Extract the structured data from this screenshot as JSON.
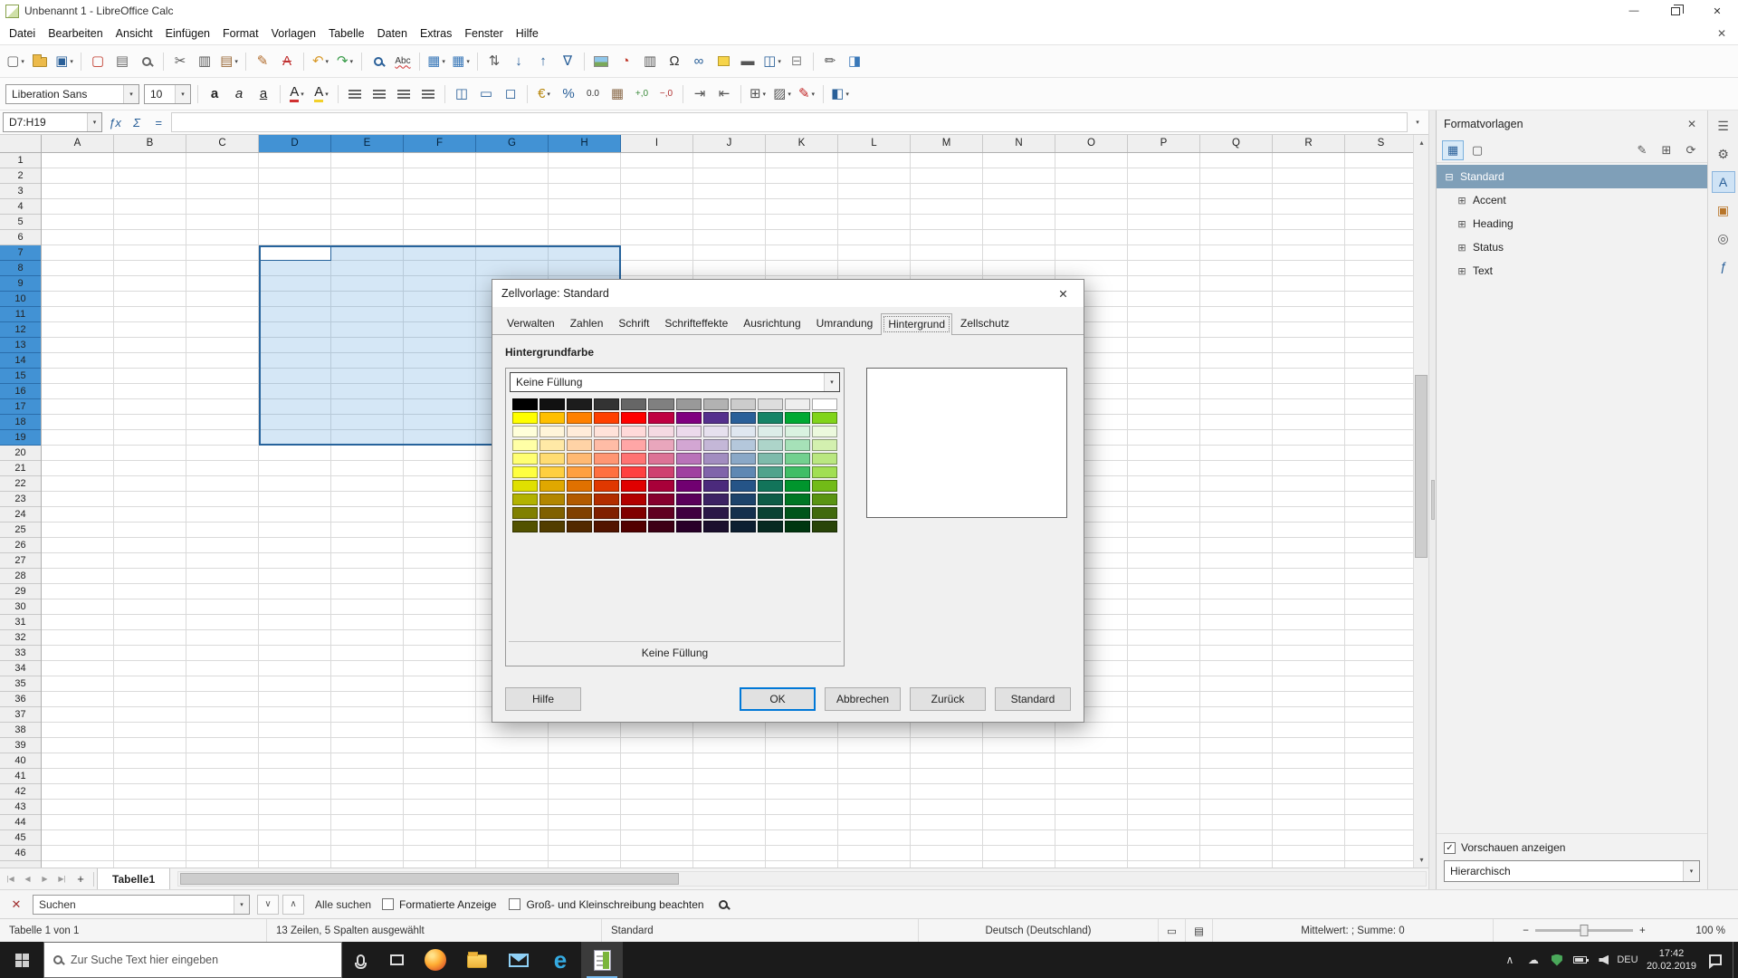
{
  "theme": {
    "selection_blue": "#4292d4",
    "ok_border": "#0078d7",
    "taskbar_bg": "#1b1b1b",
    "tree_selected": "#7f9fb8"
  },
  "window": {
    "title": "Unbenannt 1 - LibreOffice Calc",
    "minimize_glyph": "—",
    "close_glyph": "✕",
    "close_document_glyph": "✕"
  },
  "menubar": {
    "items": [
      "Datei",
      "Bearbeiten",
      "Ansicht",
      "Einfügen",
      "Format",
      "Vorlagen",
      "Tabelle",
      "Daten",
      "Extras",
      "Fenster",
      "Hilfe"
    ]
  },
  "toolbar_standard": {
    "items": [
      {
        "name": "new-button",
        "glyph": "▢",
        "color": "#666",
        "caret": true
      },
      {
        "name": "open-button",
        "cls": "ic-folder"
      },
      {
        "name": "save-button",
        "glyph": "▣",
        "color": "#2a6099",
        "caret": true
      },
      {
        "sep": true
      },
      {
        "name": "export-pdf-button",
        "glyph": "▢",
        "color": "#c0392b"
      },
      {
        "name": "print-button",
        "glyph": "▤",
        "color": "#666"
      },
      {
        "name": "print-preview-button",
        "cls": "ic-mag",
        "color": "#666"
      },
      {
        "sep": true
      },
      {
        "name": "cut-button",
        "glyph": "✂",
        "color": "#555"
      },
      {
        "name": "copy-button",
        "glyph": "▥",
        "color": "#555"
      },
      {
        "name": "paste-button",
        "glyph": "▤",
        "color": "#9a6a3a",
        "caret": true
      },
      {
        "sep": true
      },
      {
        "name": "clone-formatting-button",
        "glyph": "✎",
        "color": "#b06a2a"
      },
      {
        "name": "clear-formatting-button",
        "glyph": "A",
        "color": "#c03030",
        "strike": true
      },
      {
        "sep": true
      },
      {
        "name": "undo-button",
        "glyph": "↶",
        "color": "#d89a2a",
        "caret": true
      },
      {
        "name": "redo-button",
        "glyph": "↷",
        "color": "#3a9c4a",
        "caret": true
      },
      {
        "sep": true
      },
      {
        "name": "find-replace-button",
        "cls": "ic-mag",
        "color": "#2a6099"
      },
      {
        "name": "spelling-button",
        "glyph": "Abc",
        "color": "#333",
        "spell": true
      },
      {
        "sep": true
      },
      {
        "name": "insert-row-button",
        "glyph": "▦",
        "color": "#3a78b8",
        "caret": true
      },
      {
        "name": "insert-column-button",
        "glyph": "▦",
        "color": "#3a78b8",
        "caret": true
      },
      {
        "sep": true
      },
      {
        "name": "sort-button",
        "glyph": "⇅",
        "color": "#555"
      },
      {
        "name": "sort-ascending-button",
        "glyph": "↓",
        "color": "#2a6099"
      },
      {
        "name": "sort-descending-button",
        "glyph": "↑",
        "color": "#2a6099"
      },
      {
        "name": "autofilter-button",
        "glyph": "∇",
        "color": "#2a6099"
      },
      {
        "sep": true
      },
      {
        "name": "insert-image-button",
        "cls": "ic-pic"
      },
      {
        "name": "insert-chart-button",
        "glyph": "◔",
        "color": "#c0392b"
      },
      {
        "name": "insert-pivot-table-button",
        "glyph": "▥",
        "color": "#555"
      },
      {
        "name": "special-character-button",
        "glyph": "Ω",
        "color": "#333"
      },
      {
        "name": "insert-hyperlink-button",
        "glyph": "∞",
        "color": "#2a6099"
      },
      {
        "name": "insert-comment-button",
        "cls": "ic-note"
      },
      {
        "name": "headers-footers-button",
        "glyph": "▬",
        "color": "#555"
      },
      {
        "name": "freeze-button",
        "glyph": "◫",
        "color": "#2a6099",
        "caret": true
      },
      {
        "name": "split-window-button",
        "glyph": "⊟",
        "color": "#888"
      },
      {
        "sep": true
      },
      {
        "name": "show-draw-functions-button",
        "glyph": "✏",
        "color": "#555"
      },
      {
        "name": "sidebar-button",
        "glyph": "◨",
        "color": "#3a78b8"
      }
    ]
  },
  "toolbar_formatting": {
    "items": [
      {
        "type": "combo",
        "name": "font-name-combo",
        "value": "Liberation Sans",
        "width": 148
      },
      {
        "type": "combo",
        "name": "font-size-combo",
        "value": "10",
        "width": 52
      },
      {
        "sep": true
      },
      {
        "name": "bold-button",
        "glyph": "a",
        "color": "#222",
        "bold": true
      },
      {
        "name": "italic-button",
        "glyph": "a",
        "color": "#222",
        "italic": true
      },
      {
        "name": "underline-button",
        "glyph": "a",
        "color": "#222",
        "underline": true
      },
      {
        "sep": true
      },
      {
        "name": "font-color-button",
        "glyph": "A",
        "color": "#222",
        "ubar": "#d03030",
        "caret": true
      },
      {
        "name": "highlighting-color-button",
        "glyph": "A",
        "color": "#222",
        "ubar": "#f2d02a",
        "caret": true
      },
      {
        "sep": true
      },
      {
        "name": "align-left-button",
        "bars": "l"
      },
      {
        "name": "align-center-button",
        "bars": "c"
      },
      {
        "name": "align-right-button",
        "bars": "r"
      },
      {
        "name": "align-justified-button",
        "bars": "j"
      },
      {
        "sep": true
      },
      {
        "name": "merge-and-center-button",
        "glyph": "◫",
        "color": "#2a6099"
      },
      {
        "name": "merge-cells-button",
        "glyph": "▭",
        "color": "#2a6099"
      },
      {
        "name": "unmerge-cells-button",
        "glyph": "◻",
        "color": "#2a6099"
      },
      {
        "sep": true
      },
      {
        "name": "format-currency-button",
        "glyph": "€",
        "color": "#b8860b",
        "caret": true
      },
      {
        "name": "format-percent-button",
        "glyph": "%",
        "color": "#2a6099"
      },
      {
        "name": "format-number-button",
        "glyph": "0.0",
        "color": "#333",
        "small": true
      },
      {
        "name": "format-date-button",
        "glyph": "▦",
        "color": "#8a6a4a"
      },
      {
        "name": "add-decimal-button",
        "glyph": "+,0",
        "color": "#3a8a3a",
        "small": true
      },
      {
        "name": "delete-decimal-button",
        "glyph": "−,0",
        "color": "#b03030",
        "small": true
      },
      {
        "sep": true
      },
      {
        "name": "increase-indent-button",
        "glyph": "⇥",
        "color": "#555"
      },
      {
        "name": "decrease-indent-button",
        "glyph": "⇤",
        "color": "#555"
      },
      {
        "sep": true
      },
      {
        "name": "borders-button",
        "glyph": "⊞",
        "color": "#555",
        "caret": true
      },
      {
        "name": "border-style-button",
        "glyph": "▨",
        "color": "#555",
        "caret": true
      },
      {
        "name": "border-color-button",
        "glyph": "✎",
        "color": "#c02020",
        "caret": true
      },
      {
        "sep": true
      },
      {
        "name": "conditional-formatting-button",
        "glyph": "◧",
        "color": "#2a6099",
        "caret": true
      }
    ]
  },
  "formula_bar": {
    "name_box": "D7:H19",
    "arrow_glyph": "▾",
    "expand_glyph": "▾",
    "input_value": "",
    "icons": [
      {
        "name": "function-wizard-button",
        "glyph": "ƒx"
      },
      {
        "name": "sum-button",
        "glyph": "Σ"
      },
      {
        "name": "formula-button",
        "glyph": "="
      }
    ]
  },
  "grid": {
    "columns": [
      "A",
      "B",
      "C",
      "D",
      "E",
      "F",
      "G",
      "H",
      "I",
      "J",
      "K",
      "L",
      "M",
      "N",
      "O",
      "P",
      "Q",
      "R",
      "S"
    ],
    "row_count": 46,
    "selection": {
      "range": "D7:H19",
      "col_start": 3,
      "col_end": 7,
      "row_start": 7,
      "row_end": 19
    },
    "vscroll_up": "▴",
    "vscroll_down": "▾"
  },
  "dialog": {
    "title": "Zellvorlage: Standard",
    "close_glyph": "✕",
    "tabs": [
      {
        "label": "Verwalten"
      },
      {
        "label": "Zahlen"
      },
      {
        "label": "Schrift"
      },
      {
        "label": "Schrifteffekte"
      },
      {
        "label": "Ausrichtung"
      },
      {
        "label": "Umrandung"
      },
      {
        "label": "Hintergrund",
        "active": true
      },
      {
        "label": "Zellschutz"
      }
    ],
    "section_label": "Hintergrundfarbe",
    "fill_select_value": "Keine Füllung",
    "caption": "Keine Füllung",
    "palette_rows": [
      [
        "#000000",
        "#111111",
        "#1C1C1C",
        "#333333",
        "#666666",
        "#808080",
        "#999999",
        "#B2B2B2",
        "#CCCCCC",
        "#DDDDDD",
        "#EEEEEE",
        "#FFFFFF"
      ],
      [
        "#FFFF00",
        "#FFBF00",
        "#FF8000",
        "#FF4000",
        "#FF0000",
        "#BF0041",
        "#800080",
        "#55308D",
        "#2A6099",
        "#158466",
        "#00A933",
        "#81D41A"
      ],
      [
        "#FFFFD9",
        "#FFF5D9",
        "#FFECD9",
        "#FFE2D9",
        "#FFD9D9",
        "#F5D9E2",
        "#ECD9EC",
        "#E6E0EE",
        "#DFE7F0",
        "#DCEDE8",
        "#D9F2E0",
        "#ECF9DD"
      ],
      [
        "#FFFFA6",
        "#FFE9A6",
        "#FFD3A6",
        "#FFBCA6",
        "#FFA6A6",
        "#E9A6BC",
        "#D3A6D3",
        "#C4B7D7",
        "#B4C7DB",
        "#ADD4C9",
        "#A6E1B8",
        "#D3F0AF"
      ],
      [
        "#FFFF73",
        "#FFDC73",
        "#FFB973",
        "#FF9673",
        "#FF7373",
        "#DC7396",
        "#B973B9",
        "#A28DC0",
        "#8AA8C7",
        "#7EBBAB",
        "#73D08F",
        "#BAE781"
      ],
      [
        "#FFFF40",
        "#FFCF40",
        "#FFA040",
        "#FF7040",
        "#FF4040",
        "#CF4070",
        "#A040A0",
        "#8064AA",
        "#5F88B3",
        "#50A38C",
        "#40BE66",
        "#A1DF53"
      ],
      [
        "#E0E000",
        "#E0A800",
        "#E07100",
        "#E03800",
        "#E00000",
        "#A80039",
        "#710071",
        "#4B2A7C",
        "#255487",
        "#12745A",
        "#00952D",
        "#72BB17"
      ],
      [
        "#B2B200",
        "#B28600",
        "#B25A00",
        "#B22D00",
        "#B20000",
        "#86002E",
        "#5A005A",
        "#3C2263",
        "#1D436B",
        "#0F5C47",
        "#007624",
        "#5A9412"
      ],
      [
        "#808000",
        "#806000",
        "#804000",
        "#802000",
        "#800000",
        "#600021",
        "#400040",
        "#2B1847",
        "#15304D",
        "#0B4233",
        "#00551A",
        "#416A0D"
      ],
      [
        "#525200",
        "#523D00",
        "#522900",
        "#521400",
        "#520000",
        "#3D0015",
        "#290029",
        "#1B0F2D",
        "#0D1F31",
        "#072A21",
        "#003610",
        "#294408"
      ]
    ],
    "buttons": {
      "help": "Hilfe",
      "ok": "OK",
      "cancel": "Abbrechen",
      "back": "Zurück",
      "standard": "Standard"
    }
  },
  "sidebar": {
    "title": "Formatvorlagen",
    "close_glyph": "✕",
    "check_glyph": "✓",
    "tools_left": [
      {
        "name": "cell-styles-button",
        "glyph": "▦",
        "color": "#2a6099",
        "active": true
      },
      {
        "name": "page-styles-button",
        "glyph": "▢",
        "color": "#555"
      }
    ],
    "tools_right": [
      {
        "name": "fill-format-button",
        "glyph": "✎",
        "color": "#555"
      },
      {
        "name": "new-style-button",
        "glyph": "⊞",
        "color": "#555"
      },
      {
        "name": "update-style-button",
        "glyph": "⟳",
        "color": "#555"
      }
    ],
    "tree": [
      {
        "label": "Standard",
        "expander": "⊟",
        "selected": true,
        "level": 0
      },
      {
        "label": "Accent",
        "expander": "⊞",
        "level": 1
      },
      {
        "label": "Heading",
        "expander": "⊞",
        "level": 1
      },
      {
        "label": "Status",
        "expander": "⊞",
        "level": 1
      },
      {
        "label": "Text",
        "expander": "⊞",
        "level": 1
      }
    ],
    "previews_label": "Vorschauen anzeigen",
    "previews_checked": true,
    "filter_value": "Hierarchisch",
    "deck": [
      {
        "name": "sidebar-settings-button",
        "glyph": "☰",
        "color": "#555"
      },
      {
        "name": "deck-properties-button",
        "glyph": "⚙",
        "color": "#555"
      },
      {
        "name": "deck-styles-button",
        "glyph": "A",
        "color": "#2a6099",
        "active": true
      },
      {
        "name": "deck-gallery-button",
        "glyph": "▣",
        "color": "#b8762a"
      },
      {
        "name": "deck-navigator-button",
        "glyph": "◎",
        "color": "#555"
      },
      {
        "name": "deck-functions-button",
        "glyph": "ƒ",
        "color": "#2a6099"
      }
    ]
  },
  "sheet_tabs": {
    "nav": [
      {
        "name": "first-sheet-button",
        "glyph": "|◀"
      },
      {
        "name": "previous-sheet-button",
        "glyph": "◀"
      },
      {
        "name": "next-sheet-button",
        "glyph": "▶"
      },
      {
        "name": "last-sheet-button",
        "glyph": "▶|"
      }
    ],
    "add_glyph": "+",
    "tabs": [
      "Tabelle1"
    ],
    "active_index": 0
  },
  "find_bar": {
    "close_glyph": "✕",
    "search_value": "Suchen",
    "arrow_glyph": "▾",
    "nav": [
      {
        "name": "find-next-button",
        "glyph": "∨"
      },
      {
        "name": "find-previous-button",
        "glyph": "∧"
      }
    ],
    "all_label": "Alle suchen",
    "checkboxes": [
      "Formatierte Anzeige",
      "Groß- und Kleinschreibung beachten"
    ]
  },
  "status_bar": {
    "sheet_info": "Tabelle 1 von 1",
    "selection_info": "13 Zeilen, 5 Spalten ausgewählt",
    "page_style": "Standard",
    "language": "Deutsch (Deutschland)",
    "selection_mode_glyph": "▭",
    "modified_glyph": "▤",
    "summary": "Mittelwert: ; Summe: 0",
    "zoom_out": "−",
    "zoom_in": "+",
    "zoom_percent": "100 %"
  },
  "taskbar": {
    "search_placeholder": "Zur Suche Text hier eingeben",
    "apps": [
      {
        "name": "firefox-icon",
        "kind": "firefox"
      },
      {
        "name": "explorer-icon",
        "kind": "explorer"
      },
      {
        "name": "mail-icon",
        "kind": "mail"
      },
      {
        "name": "edge-icon",
        "kind": "edge",
        "glyph": "e"
      },
      {
        "name": "calc-icon",
        "kind": "calc",
        "active": true
      }
    ],
    "tray": [
      {
        "name": "tray-expand-button",
        "glyph": "∧"
      },
      {
        "name": "onedrive-icon",
        "glyph": "☁"
      },
      {
        "name": "defender-icon",
        "kind": "shield"
      },
      {
        "name": "battery-icon",
        "kind": "battery"
      },
      {
        "name": "volume-icon",
        "kind": "speaker"
      }
    ],
    "language": "DEU",
    "time": "17:42",
    "date": "20.02.2019"
  }
}
